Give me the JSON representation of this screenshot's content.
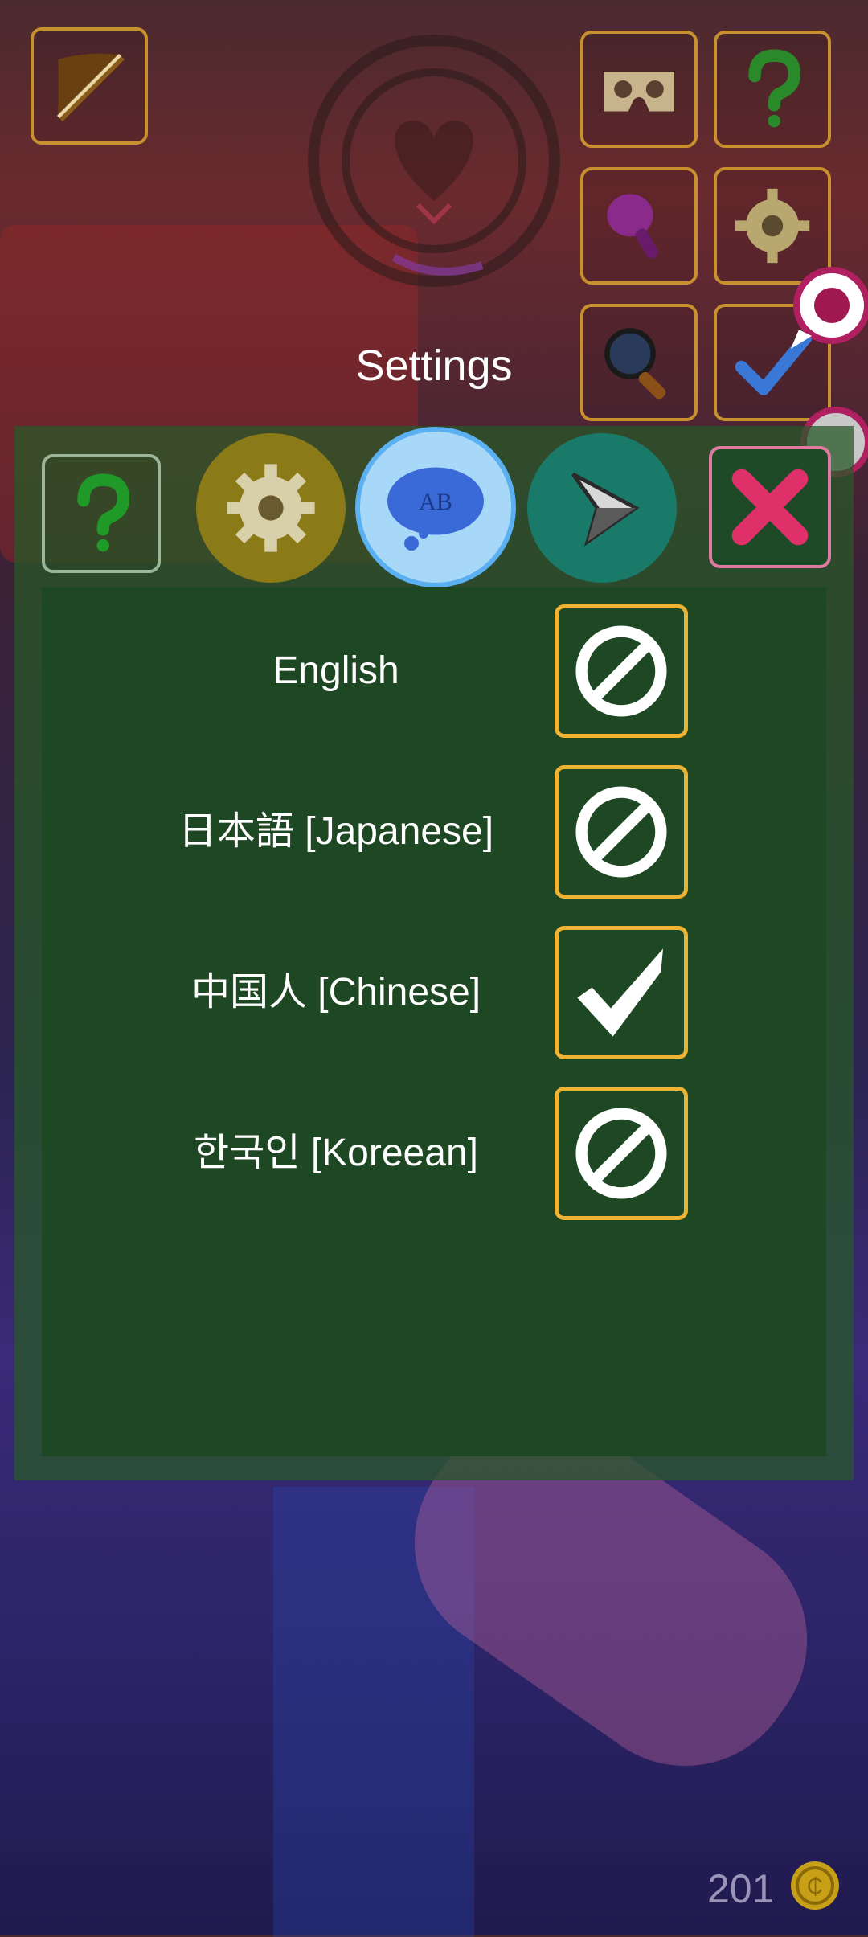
{
  "header": {
    "title": "Settings"
  },
  "top_left_button": {
    "icon": "pencil-icon"
  },
  "toolbar": [
    {
      "name": "vr-headset-button",
      "icon": "vr-headset-icon"
    },
    {
      "name": "help-top-button",
      "icon": "question-icon"
    },
    {
      "name": "plunger-button",
      "icon": "plunger-icon"
    },
    {
      "name": "settings-gear-button",
      "icon": "gear-icon"
    },
    {
      "name": "magnifier-button",
      "icon": "magnifier-icon"
    },
    {
      "name": "confirm-button",
      "icon": "checkmark-icon"
    }
  ],
  "tabs": [
    {
      "name": "tab-help",
      "icon": "question-icon"
    },
    {
      "name": "tab-general",
      "icon": "gear-icon"
    },
    {
      "name": "tab-language",
      "icon": "language-bubble-icon",
      "selected": true
    },
    {
      "name": "tab-controls",
      "icon": "cursor-arrow-icon"
    }
  ],
  "languages": [
    {
      "label": "English",
      "selected": false
    },
    {
      "label": "日本語 [Japanese]",
      "selected": false
    },
    {
      "label": "中国人 [Chinese]",
      "selected": true
    },
    {
      "label": "한국인 [Koreean]",
      "selected": false
    }
  ],
  "footer": {
    "coins": "201"
  },
  "colors": {
    "accent": "#f0b232",
    "panel": "#1e4823",
    "close": "#e0306a"
  }
}
